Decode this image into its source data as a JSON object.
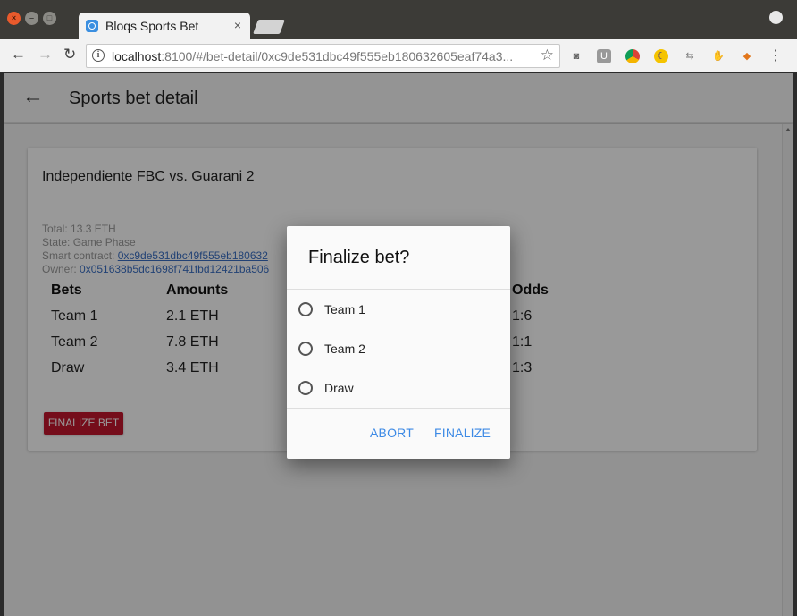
{
  "browser": {
    "tab_title": "Bloqs Sports Bet",
    "tab_close": "×",
    "url_host": "localhost",
    "url_rest": ":8100/#/bet-detail/0xc9de531dbc49f555eb180632605eaf74a3...",
    "extension_icons": [
      "camera-icon",
      "u-icon",
      "chrome-icon",
      "moon-icon",
      "sync-icon",
      "gnome-icon",
      "fox-icon",
      "menu-icon"
    ]
  },
  "header": {
    "title": "Sports bet detail"
  },
  "card": {
    "title": "Independiente FBC vs. Guarani 2",
    "total": "Total: 13.3 ETH",
    "state": "State: Game Phase",
    "contract_label": "Smart contract: ",
    "contract_value": "0xc9de531dbc49f555eb180632",
    "owner_label": "Owner: ",
    "owner_value": "0x051638b5dc1698f741fbd12421ba506",
    "table": {
      "headers": [
        "Bets",
        "Amounts",
        "Odds"
      ],
      "rows": [
        {
          "bet": "Team 1",
          "amount": "2.1 ETH",
          "odds": "1:6"
        },
        {
          "bet": "Team 2",
          "amount": "7.8 ETH",
          "odds": "1:1"
        },
        {
          "bet": "Draw",
          "amount": "3.4 ETH",
          "odds": "1:3"
        }
      ]
    },
    "finalize_label": "FINALIZE BET"
  },
  "dialog": {
    "title": "Finalize bet?",
    "options": [
      "Team 1",
      "Team 2",
      "Draw"
    ],
    "abort_label": "ABORT",
    "finalize_label": "FINALIZE"
  }
}
